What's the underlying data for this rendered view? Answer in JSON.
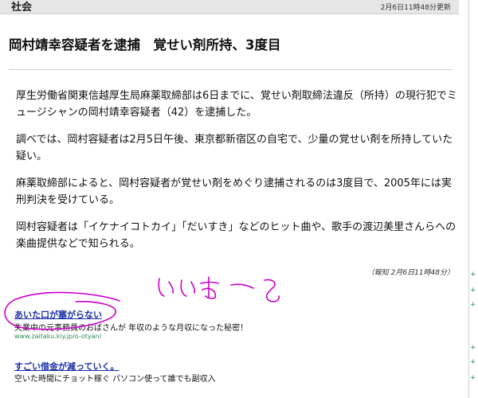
{
  "header": {
    "section": "社会",
    "updated": "2月6日11時48分更新"
  },
  "article": {
    "headline": "岡村靖幸容疑者を逮捕　覚せい剤所持、3度目",
    "paragraphs": [
      "厚生労働省関東信越厚生局麻薬取締部は6日までに、覚せい剤取締法違反（所持）の現行犯でミュージシャンの岡村靖幸容疑者（42）を逮捕した。",
      "調べでは、岡村容疑者は2月5日午後、東京都新宿区の自宅で、少量の覚せい剤を所持していた疑い。",
      "麻薬取締部によると、岡村容疑者が覚せい剤をめぐり逮捕されるのは3度目で、2005年には実刑判決を受けている。",
      "岡村容疑者は「イケナイコトカイ」「だいすき」などのヒット曲や、歌手の渡辺美里さんらへの楽曲提供などで知られる。"
    ],
    "credit": "（報知 2月6日11時48分）"
  },
  "ads": [
    {
      "title": "あいた口が塞がらない",
      "text": "失業中の元事務員のおばさんが 年収のような月収になった秘密！",
      "url": "www.zaitaku.kiy.jp/o-otyan/"
    },
    {
      "title": "すごい借金が減っていく。",
      "text": "空いた時間にチョット稼ぐ パソコン使って誰でも副収入",
      "url": ""
    }
  ],
  "annotation": {
    "handwriting": "いいえてる"
  },
  "right_edge": {
    "marks": [
      "+",
      "+",
      "+",
      "+",
      "+",
      "+"
    ]
  },
  "colors": {
    "ad_title": "#1a2fa8",
    "ad_url": "#2e8b57",
    "scribble": "#cc00cc"
  }
}
